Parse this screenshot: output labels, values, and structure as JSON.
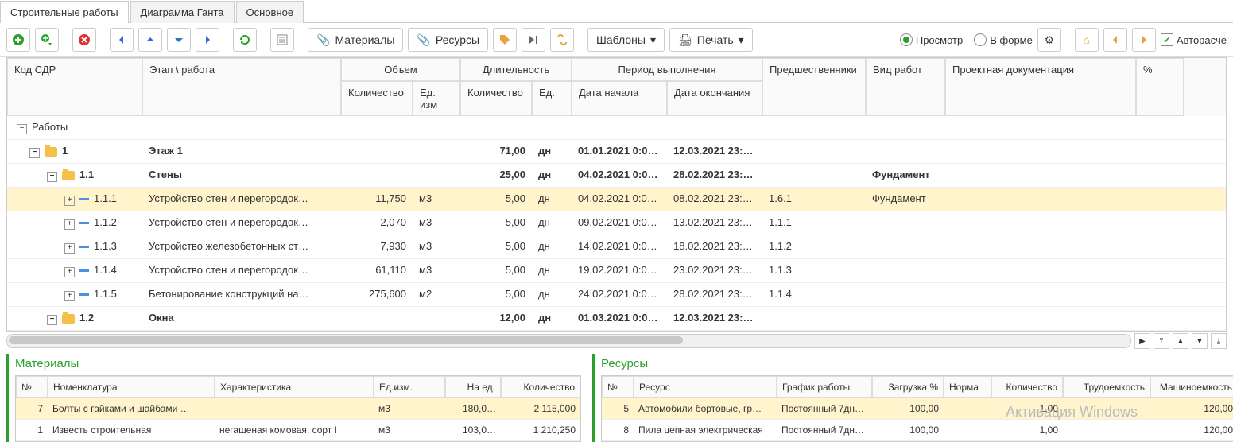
{
  "tabs": [
    "Строительные работы",
    "Диаграмма Ганта",
    "Основное"
  ],
  "active_tab": 0,
  "toolbar": {
    "materials": "Материалы",
    "resources": "Ресурсы",
    "templates": "Шаблоны",
    "print": "Печать"
  },
  "view": {
    "preview": "Просмотр",
    "inform": "В форме",
    "autoexpand": "Авторасче"
  },
  "grid": {
    "headers": {
      "code": "Код СДР",
      "stage": "Этап \\ работа",
      "volume": "Объем",
      "duration": "Длительность",
      "period": "Период выполнения",
      "pred": "Предшественники",
      "workkind": "Вид работ",
      "proj": "Проектная документация",
      "pct": "%",
      "qty": "Количество",
      "unit": "Ед. изм",
      "qty2": "Количество",
      "unit2": "Ед.",
      "start": "Дата начала",
      "end": "Дата окончания"
    },
    "root": "Работы",
    "rows": [
      {
        "type": "stage",
        "level": 1,
        "code": "1",
        "name": "Этаж 1",
        "dur": "71,00",
        "du": "дн",
        "start": "01.01.2021 0:00…",
        "end": "12.03.2021 23:59…",
        "pred": "",
        "kind": ""
      },
      {
        "type": "stage",
        "level": 2,
        "code": "1.1",
        "name": "Стены",
        "dur": "25,00",
        "du": "дн",
        "start": "04.02.2021 0:00…",
        "end": "28.02.2021 23:59…",
        "pred": "",
        "kind": "Фундамент"
      },
      {
        "type": "work",
        "level": 3,
        "code": "1.1.1",
        "name": "Устройство стен и перегородок…",
        "qty": "11,750",
        "unit": "м3",
        "dur": "5,00",
        "du": "дн",
        "start": "04.02.2021 0:00…",
        "end": "08.02.2021 23:59…",
        "pred": "1.6.1",
        "kind": "Фундамент",
        "selected": true
      },
      {
        "type": "work",
        "level": 3,
        "code": "1.1.2",
        "name": "Устройство стен и перегородок…",
        "qty": "2,070",
        "unit": "м3",
        "dur": "5,00",
        "du": "дн",
        "start": "09.02.2021 0:00…",
        "end": "13.02.2021 23:59…",
        "pred": "1.1.1",
        "kind": ""
      },
      {
        "type": "work",
        "level": 3,
        "code": "1.1.3",
        "name": "Устройство железобетонных ст…",
        "qty": "7,930",
        "unit": "м3",
        "dur": "5,00",
        "du": "дн",
        "start": "14.02.2021 0:00…",
        "end": "18.02.2021 23:59…",
        "pred": "1.1.2",
        "kind": ""
      },
      {
        "type": "work",
        "level": 3,
        "code": "1.1.4",
        "name": "Устройство стен и перегородок…",
        "qty": "61,110",
        "unit": "м3",
        "dur": "5,00",
        "du": "дн",
        "start": "19.02.2021 0:00…",
        "end": "23.02.2021 23:59…",
        "pred": "1.1.3",
        "kind": ""
      },
      {
        "type": "work",
        "level": 3,
        "code": "1.1.5",
        "name": "Бетонирование конструкций на…",
        "qty": "275,600",
        "unit": "м2",
        "dur": "5,00",
        "du": "дн",
        "start": "24.02.2021 0:00…",
        "end": "28.02.2021 23:59…",
        "pred": "1.1.4",
        "kind": ""
      },
      {
        "type": "stage",
        "level": 2,
        "code": "1.2",
        "name": "Окна",
        "dur": "12,00",
        "du": "дн",
        "start": "01.03.2021 0:00…",
        "end": "12.03.2021 23:59…",
        "pred": "",
        "kind": ""
      }
    ]
  },
  "materials": {
    "title": "Материалы",
    "headers": {
      "n": "№",
      "nom": "Номенклатура",
      "char": "Характеристика",
      "unit": "Ед.изм.",
      "per": "На ед.",
      "qty": "Количество"
    },
    "rows": [
      {
        "n": "7",
        "nom": "Болты с гайками и шайбами …",
        "char": "",
        "unit": "м3",
        "per": "180,0…",
        "qty": "2 115,000",
        "selected": true
      },
      {
        "n": "1",
        "nom": "Известь строительная",
        "char": "негашеная комовая, сорт I",
        "unit": "м3",
        "per": "103,0…",
        "qty": "1 210,250"
      }
    ]
  },
  "resources": {
    "title": "Ресурсы",
    "headers": {
      "n": "№",
      "res": "Ресурс",
      "sched": "График работы",
      "load": "Загрузка %",
      "norm": "Норма",
      "qty": "Количество",
      "labor": "Трудоемкость",
      "mach": "Машиноемкость"
    },
    "rows": [
      {
        "n": "5",
        "res": "Автомобили бортовые, гр…",
        "sched": "Постоянный 7дн…",
        "load": "100,00",
        "norm": "",
        "qty": "1,00",
        "labor": "",
        "mach": "120,00",
        "selected": true
      },
      {
        "n": "8",
        "res": "Пила цепная электрическая",
        "sched": "Постоянный 7дн…",
        "load": "100,00",
        "norm": "",
        "qty": "1,00",
        "labor": "",
        "mach": "120,00"
      }
    ]
  },
  "watermark": "Активация Windows"
}
